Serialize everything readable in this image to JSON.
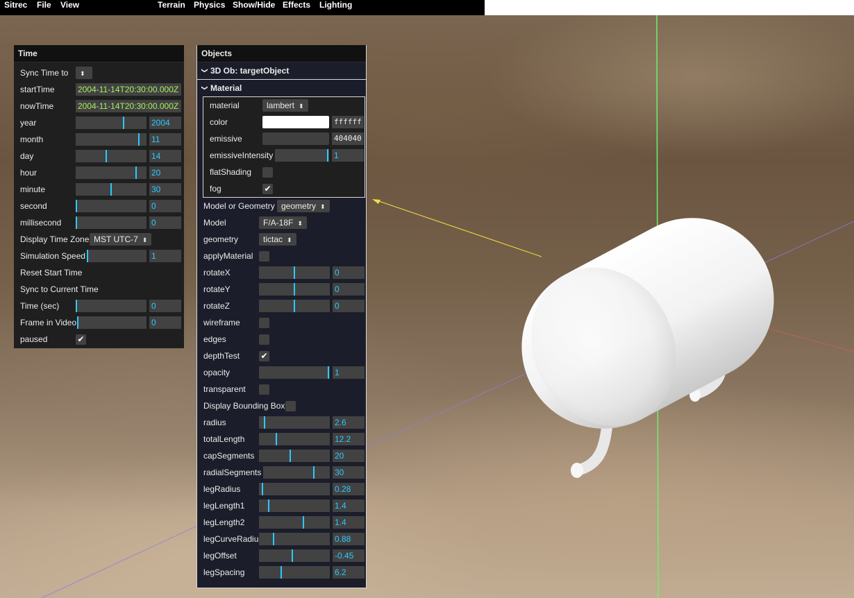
{
  "menu": {
    "items": [
      "Sitrec",
      "File",
      "View",
      "Terrain",
      "Physics",
      "Show/Hide",
      "Effects",
      "Lighting"
    ]
  },
  "time_panel": {
    "title": "Time",
    "sync_time_to_label": "Sync Time to",
    "start_time_label": "startTime",
    "start_time_value": "2004-11-14T20:30:00.000Z",
    "now_time_label": "nowTime",
    "now_time_value": "2004-11-14T20:30:00.000Z",
    "sliders": [
      {
        "label": "year",
        "value": "2004",
        "fraction": 0.68
      },
      {
        "label": "month",
        "value": "11",
        "fraction": 0.9
      },
      {
        "label": "day",
        "value": "14",
        "fraction": 0.43
      },
      {
        "label": "hour",
        "value": "20",
        "fraction": 0.86
      },
      {
        "label": "minute",
        "value": "30",
        "fraction": 0.5
      },
      {
        "label": "second",
        "value": "0",
        "fraction": 0.0
      },
      {
        "label": "millisecond",
        "value": "0",
        "fraction": 0.0
      }
    ],
    "display_time_zone_label": "Display Time Zone",
    "display_time_zone_value": "MST UTC-7",
    "simulation_speed_label": "Simulation Speed",
    "simulation_speed_value": "1",
    "reset_start_time_label": "Reset Start Time",
    "sync_current_time_label": "Sync to Current Time",
    "time_sec_label": "Time (sec)",
    "time_sec_value": "0",
    "frame_in_video_label": "Frame in Video",
    "frame_in_video_value": "0",
    "paused_label": "paused",
    "paused_checked": true
  },
  "objects_panel": {
    "title": "Objects",
    "object_folder": "3D Ob: targetObject",
    "material_folder": "Material",
    "material": {
      "material_label": "material",
      "material_value": "lambert",
      "color_label": "color",
      "color_hex": "ffffff",
      "emissive_label": "emissive",
      "emissive_hex": "404040",
      "emissive_intensity_label": "emissiveIntensity",
      "emissive_intensity_value": "1",
      "flat_shading_label": "flatShading",
      "flat_shading_checked": false,
      "fog_label": "fog",
      "fog_checked": true
    },
    "model_or_geometry_label": "Model or Geometry",
    "model_or_geometry_value": "geometry",
    "model_label": "Model",
    "model_value": "F/A-18F",
    "geometry_label": "geometry",
    "geometry_value": "tictac",
    "apply_material_label": "applyMaterial",
    "apply_material_checked": false,
    "rotations": [
      {
        "label": "rotateX",
        "value": "0",
        "fraction": 0.5
      },
      {
        "label": "rotateY",
        "value": "0",
        "fraction": 0.5
      },
      {
        "label": "rotateZ",
        "value": "0",
        "fraction": 0.5
      }
    ],
    "wireframe_label": "wireframe",
    "wireframe_checked": false,
    "edges_label": "edges",
    "edges_checked": false,
    "depth_test_label": "depthTest",
    "depth_test_checked": true,
    "opacity_label": "opacity",
    "opacity_value": "1",
    "opacity_fraction": 0.99,
    "transparent_label": "transparent",
    "transparent_checked": false,
    "bounding_box_label": "Display Bounding Box",
    "bounding_box_checked": false,
    "geometry_params": [
      {
        "label": "radius",
        "value": "2.6",
        "fraction": 0.07
      },
      {
        "label": "totalLength",
        "value": "12.2",
        "fraction": 0.24
      },
      {
        "label": "capSegments",
        "value": "20",
        "fraction": 0.44
      },
      {
        "label": "radialSegments",
        "value": "30",
        "fraction": 0.72
      },
      {
        "label": "legRadius",
        "value": "0.28",
        "fraction": 0.04
      },
      {
        "label": "legLength1",
        "value": "1.4",
        "fraction": 0.13
      },
      {
        "label": "legLength2",
        "value": "1.4",
        "fraction": 0.63
      },
      {
        "label": "legCurveRadius",
        "value": "0.88",
        "fraction": 0.2
      },
      {
        "label": "legOffset",
        "value": "-0.45",
        "fraction": 0.47
      },
      {
        "label": "legSpacing",
        "value": "6.2",
        "fraction": 0.31
      }
    ]
  },
  "colors": {
    "accent": "#2cc9ff",
    "date_text": "#a6f15a",
    "panel_bg": "#1f1f1f",
    "objects_bg": "#1b1d2a"
  }
}
